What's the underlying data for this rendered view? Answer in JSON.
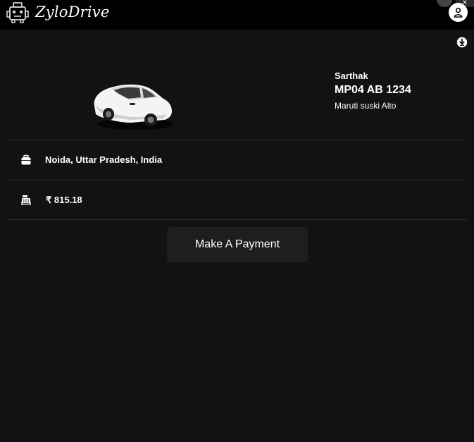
{
  "header": {
    "brand": "ZyloDrive",
    "close_glyph": "×",
    "logo_icon": "robot-car-icon",
    "avatar_icon": "user-icon"
  },
  "ride": {
    "download_icon": "download-circle-icon",
    "car_icon": "white-car-illustration",
    "driver_name": "Sarthak",
    "plate_number": "MP04 AB 1234",
    "car_model": "Maruti suski Alto"
  },
  "details": {
    "location_icon": "briefcase-icon",
    "location": "Noida, Uttar Pradesh, India",
    "fare_icon": "cash-register-icon",
    "fare": "₹ 815.18"
  },
  "actions": {
    "payment_label": "Make A Payment"
  },
  "colors": {
    "background": "#121212",
    "topbar": "#000000",
    "button_bg": "#1e1e1e",
    "divider": "#2a2a2a",
    "text": "#ffffff"
  }
}
